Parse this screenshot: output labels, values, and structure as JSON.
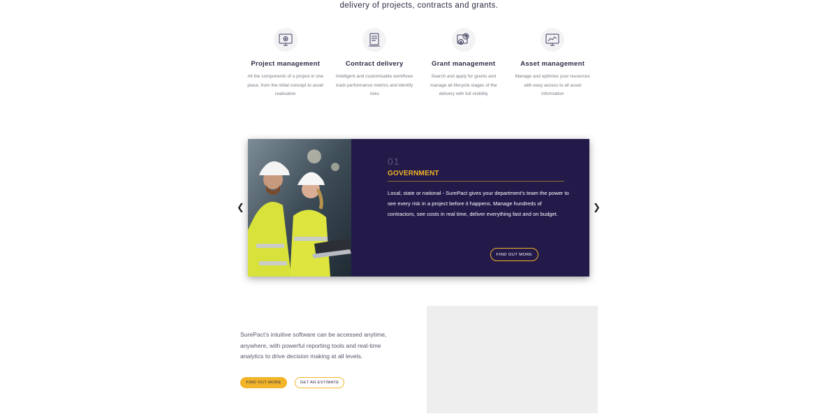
{
  "intro": {
    "text": "delivery of projects, contracts and grants."
  },
  "features": [
    {
      "icon": "computer-gear-icon",
      "title": "Project management",
      "desc": "All the components of a project in one place, from the initial concept to asset realisation"
    },
    {
      "icon": "document-pen-icon",
      "title": "Contract delivery",
      "desc": "Intelligent and customisable workflows track performance metrics and identify risks"
    },
    {
      "icon": "gears-screen-icon",
      "title": "Grant management",
      "desc": "Search and apply for grants and manage all lifecycle stages of the delivery with full visibility"
    },
    {
      "icon": "monitor-chart-icon",
      "title": "Asset management",
      "desc": "Manage and optimise your resources with easy access to all asset information"
    }
  ],
  "slider": {
    "number": "01",
    "heading": "GOVERNMENT",
    "text": "Local, state or national - SurePact gives your department's team the power to see every risk in a project before it happens. Manage hundreds of contractors, see costs in real time, deliver everything fast and on budget.",
    "button": "FIND OUT MORE",
    "prev_icon": "chevron-left-icon",
    "next_icon": "chevron-right-icon"
  },
  "access": {
    "text": "SurePact's intuitive software can be accessed anytime, anywhere, with powerful reporting tools and real-time analytics to drive decision making at all levels.",
    "primary_button": "FIND OUT MORE",
    "secondary_button": "GET AN ESTIMATE"
  },
  "colors": {
    "accent": "#f2b429",
    "navy": "#231a4a",
    "placeholder": "#eeeeee"
  }
}
